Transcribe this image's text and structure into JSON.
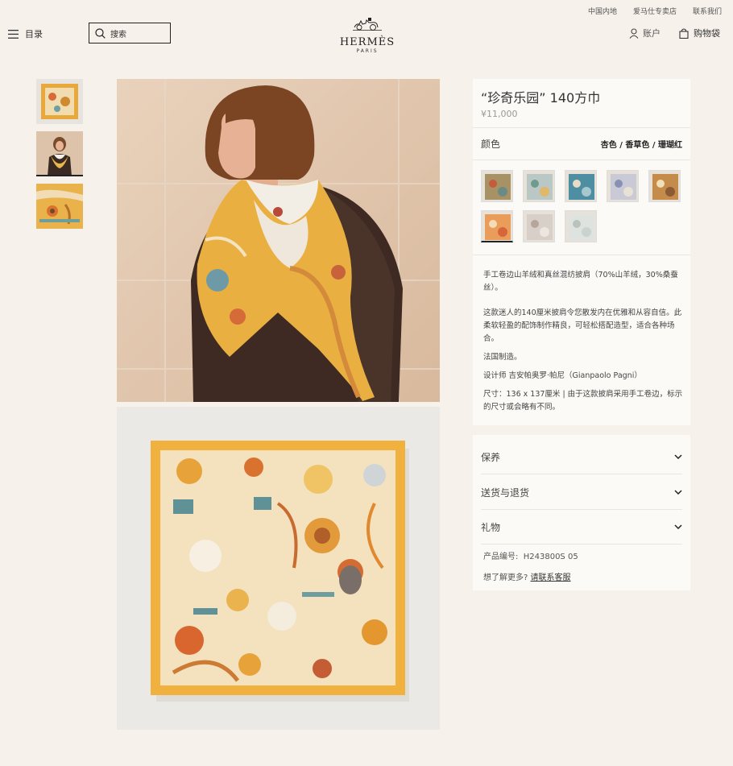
{
  "top_links": [
    "中国内地",
    "爱马仕专卖店",
    "联系我们"
  ],
  "header": {
    "menu_label": "目录",
    "search_placeholder": "搜索",
    "brand": "HERMÈS",
    "brand_city": "PARIS",
    "account_label": "账户",
    "cart_label": "购物袋"
  },
  "product": {
    "title": "“珍奇乐园” 140方巾",
    "price": "¥11,000",
    "color_label": "颜色",
    "selected_color": "杏色 / 香草色 / 珊瑚红",
    "swatch_count": 8,
    "selected_swatch": 5,
    "description": [
      "手工卷边山羊绒和真丝混纺披肩（70%山羊绒，30%桑蚕丝）。",
      "这款迷人的140厘米披肩令您散发内在优雅和从容自信。此柔软轻盈的配饰制作精良，可轻松搭配造型，适合各种场合。",
      "法国制造。",
      "设计师 吉安帕奥罗·帕尼（Gianpaolo Pagni）",
      "尺寸：136 x 137厘米 | 由于这款披肩采用手工卷边，标示的尺寸或会略有不同。"
    ]
  },
  "accordion": [
    "保养",
    "送货与退货",
    "礼物"
  ],
  "product_code_label": "产品编号:",
  "product_code": "H243800S 05",
  "more_info_label": "想了解更多?",
  "contact_link": "请联系客服",
  "colors": {
    "background": "#f6f1eb",
    "panel": "#fcfaf7",
    "scarf_yellow": "#e8a93a"
  }
}
